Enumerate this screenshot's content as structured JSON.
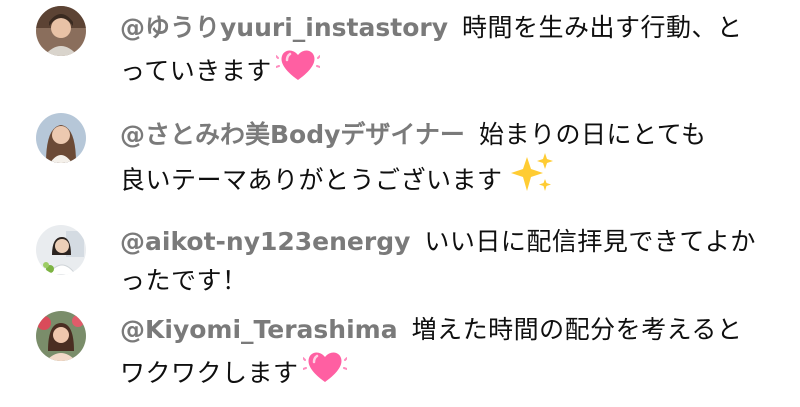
{
  "comments": [
    {
      "author": "@ゆうりyuuri_instastory",
      "line1": "時間を生み出す行動、と",
      "line2": "っていきます",
      "emoji": "heart-icon"
    },
    {
      "author": "@さとみわ美Bodyデザイナー",
      "line1": "始まりの日にとても",
      "line2": "良いテーマありがとうございます",
      "emoji": "sparkles-icon"
    },
    {
      "author": "@aikot-ny123energy",
      "line1": "いい日に配信拝見できてよか",
      "line2": "ったです！",
      "emoji": ""
    },
    {
      "author": "@Kiyomi_Terashima",
      "line1": "増えた時間の配分を考えると",
      "line2": "ワクワクします",
      "emoji": "heart-icon"
    }
  ],
  "colors": {
    "author": "#7a7a7a",
    "text": "#0f0f0f",
    "heart": "#ff5fa2",
    "sparkle": "#ffcc33"
  }
}
